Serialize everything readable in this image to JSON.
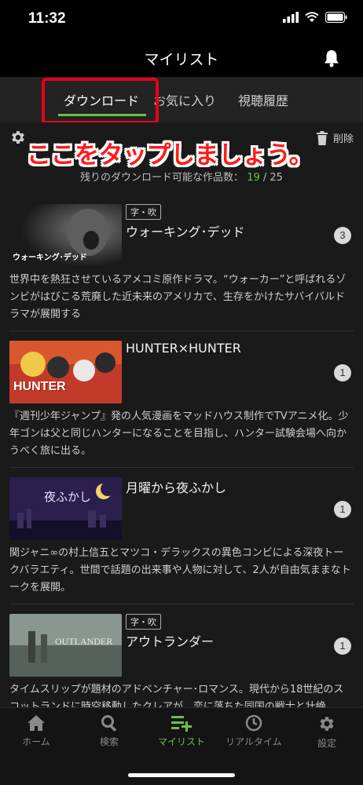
{
  "status": {
    "time": "11:32"
  },
  "header": {
    "title": "マイリスト"
  },
  "tabs": [
    {
      "label": "ダウンロード"
    },
    {
      "label": "お気に入り"
    },
    {
      "label": "視聴履歴"
    }
  ],
  "toolbar": {
    "delete_label": "削除"
  },
  "callout": "ここをタップしましょう。",
  "remaining": {
    "prefix": "残りのダウンロード可能な作品数：",
    "count": "19",
    "total": "/ 25"
  },
  "items": [
    {
      "badge": "字・吹",
      "title": "ウォーキング･デッド",
      "count": "3",
      "thumb_text": "ウォーキング･デッド",
      "desc": "世界中を熱狂させているアメコミ原作ドラマ。“ウォーカー”と呼ばれるゾンビがはびこる荒廃した近未来のアメリカで、生存をかけたサバイバルドラマが展開する"
    },
    {
      "badge": "",
      "title": "HUNTER×HUNTER",
      "count": "1",
      "thumb_text": "HUNTER",
      "desc": "『週刊少年ジャンプ』発の人気漫画をマッドハウス制作でTVアニメ化。少年ゴンは父と同じハンターになることを目指し、ハンター試験会場へ向かうべく旅に出る。"
    },
    {
      "badge": "",
      "title": "月曜から夜ふかし",
      "count": "1",
      "thumb_text": "夜ふかし",
      "desc": "関ジャニ∞の村上信五とマツコ・デラックスの異色コンビによる深夜トークバラエティ。世間で話題の出来事や人物に対して、2人が自由気ままなトークを展開。"
    },
    {
      "badge": "字・吹",
      "title": "アウトランダー",
      "count": "1",
      "thumb_text": "OUTLANDER",
      "desc": "タイムスリップが題材のアドベンチャー･ロマンス。現代から18世紀のスコットランドに時空移動したクレアが、恋に落ちた同国の戦士と壮絶"
    }
  ],
  "nav": [
    {
      "label": "ホーム",
      "icon": "home-icon"
    },
    {
      "label": "検索",
      "icon": "search-icon"
    },
    {
      "label": "マイリスト",
      "icon": "mylist-icon"
    },
    {
      "label": "リアルタイム",
      "icon": "clock-icon"
    },
    {
      "label": "設定",
      "icon": "gear-icon"
    }
  ],
  "colors": {
    "accent": "#6cc04a",
    "callout": "#ff1a1a",
    "highlight": "#e8001c"
  }
}
